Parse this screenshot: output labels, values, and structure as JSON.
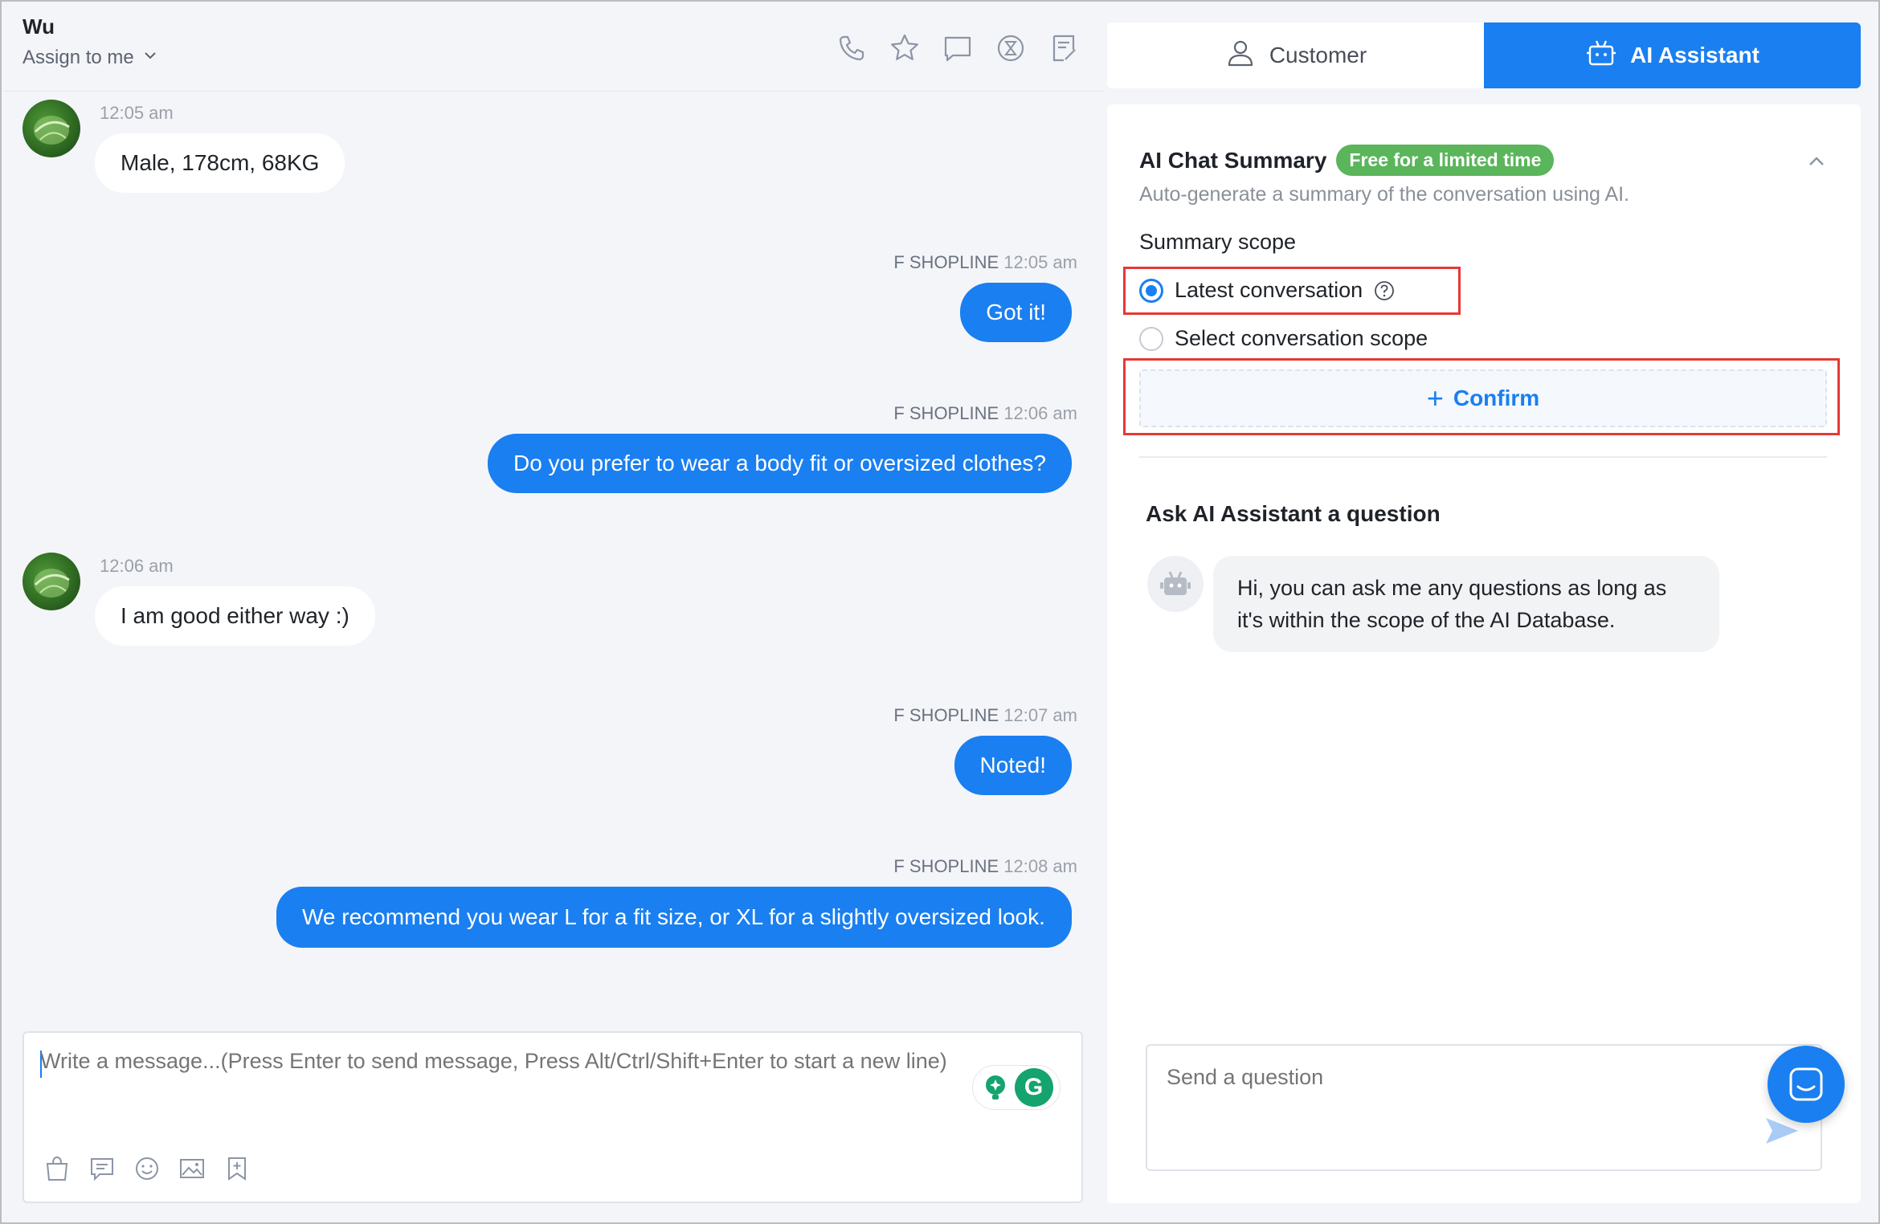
{
  "header": {
    "contact_name": "Wu",
    "assign_label": "Assign to me",
    "icons": [
      "phone-icon",
      "star-icon",
      "message-square-icon",
      "hourglass-icon",
      "note-icon"
    ]
  },
  "messages": [
    {
      "direction": "in",
      "time": "12:05 am",
      "text": "Male, 178cm, 68KG"
    },
    {
      "direction": "out",
      "sender": "F SHOPLINE",
      "time": "12:05 am",
      "text": "Got it!"
    },
    {
      "direction": "out",
      "sender": "F SHOPLINE",
      "time": "12:06 am",
      "text": "Do you prefer to wear a body fit or oversized clothes?"
    },
    {
      "direction": "in",
      "time": "12:06 am",
      "text": "I am good either way :)"
    },
    {
      "direction": "out",
      "sender": "F SHOPLINE",
      "time": "12:07 am",
      "text": "Noted!"
    },
    {
      "direction": "out",
      "sender": "F SHOPLINE",
      "time": "12:08 am",
      "text": "We recommend you wear L for a fit size, or XL for a slightly oversized look."
    }
  ],
  "composer": {
    "placeholder": "Write a message...(Press Enter to send message, Press Alt/Ctrl/Shift+Enter to start a new line)",
    "tools": [
      "bag-icon",
      "quick-reply-icon",
      "emoji-icon",
      "image-icon",
      "bookmark-add-icon"
    ]
  },
  "tabs": [
    {
      "label": "Customer",
      "active": false
    },
    {
      "label": "AI Assistant",
      "active": true
    }
  ],
  "summary": {
    "title": "AI Chat Summary",
    "badge": "Free for a limited time",
    "description": "Auto-generate a summary of the conversation using AI.",
    "scope_label": "Summary scope",
    "options": [
      {
        "label": "Latest conversation",
        "checked": true
      },
      {
        "label": "Select conversation scope",
        "checked": false
      }
    ],
    "confirm_label": "Confirm"
  },
  "assistant": {
    "title": "Ask AI Assistant a question",
    "greeting": "Hi, you can ask me any questions as long as it's within the scope of the AI Database.",
    "input_placeholder": "Send a question"
  },
  "colors": {
    "primary": "#1a7ff0",
    "badge_green": "#5bb55b",
    "highlight_red": "#e53935"
  }
}
